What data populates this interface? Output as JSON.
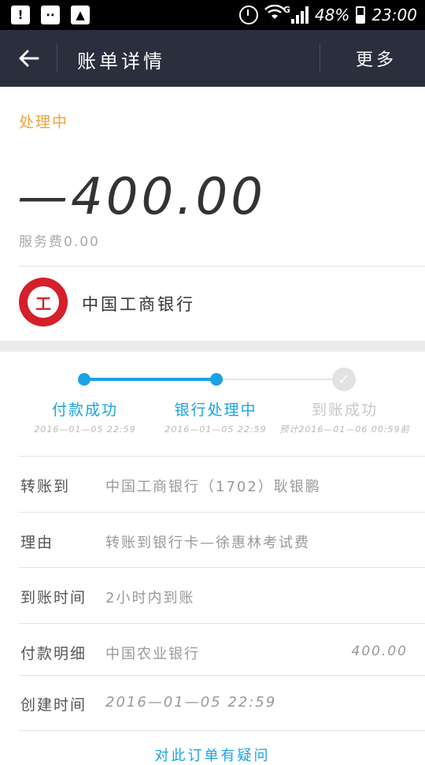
{
  "statusbar": {
    "icons_left": [
      "warning-icon",
      "chat-icon",
      "image-icon"
    ],
    "network": "G",
    "battery": "48%",
    "time": "23:00"
  },
  "header": {
    "title": "账单详情",
    "more": "更多"
  },
  "bill": {
    "status": "处理中",
    "amount": "—400.00",
    "fee": "服务费0.00",
    "bank": "中国工商银行"
  },
  "progress": {
    "steps": [
      {
        "label": "付款成功",
        "time": "2016—01—05 22:59"
      },
      {
        "label": "银行处理中",
        "time": "2016—01—05 22:59"
      },
      {
        "label": "到账成功",
        "time": "预计2016—01—06 00:59前"
      }
    ]
  },
  "details": {
    "rows": [
      {
        "label": "转账到",
        "value": "中国工商银行（1702）耿银鹏"
      },
      {
        "label": "理由",
        "value": "转账到银行卡—徐惠林考试费"
      },
      {
        "label": "到账时间",
        "value": "2小时内到账"
      },
      {
        "label": "付款明细",
        "value": "中国农业银行",
        "amount": "400.00"
      },
      {
        "label": "创建时间",
        "value": "2016—01—05  22:59"
      }
    ]
  },
  "footer": {
    "link": "对此订单有疑问"
  },
  "colors": {
    "accent": "#19a3e6",
    "status_orange": "#f0a23c",
    "header_bg": "#2a2e3d",
    "bank_red": "#d3202a"
  }
}
